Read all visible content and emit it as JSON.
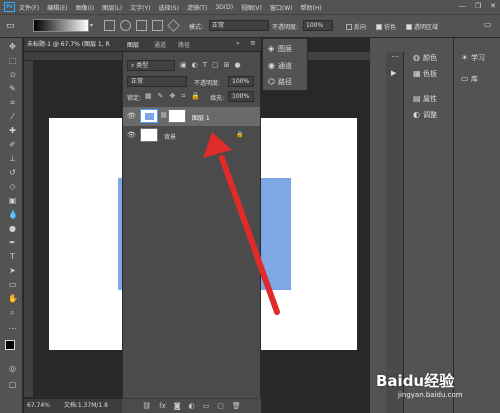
{
  "menubar": {
    "logo": "Ps",
    "items": [
      "文件(F)",
      "编辑(E)",
      "图像(I)",
      "图层(L)",
      "文字(Y)",
      "选择(S)",
      "滤镜(T)",
      "3D(D)",
      "视图(V)",
      "窗口(W)",
      "帮助(H)"
    ],
    "window_buttons": [
      "—",
      "❐",
      "✕"
    ]
  },
  "options": {
    "mode_label": "模式:",
    "mode_value": "正常",
    "opacity_label": "不透明度:",
    "opacity_value": "100%",
    "reverse_label": "反向",
    "dither_label": "仿色",
    "transparency_label": "透明区域"
  },
  "document": {
    "tab_title": "未标题-1 @ 67.7% (图层 1, R",
    "zoom": "67.74%",
    "doc_info": "文档:1.37M/1.8"
  },
  "layers_panel": {
    "tabs": [
      "图层",
      "通道",
      "路径"
    ],
    "filter_kind": "类型",
    "blend_mode": "正常",
    "opacity_label": "不透明度:",
    "opacity_value": "100%",
    "lock_label": "锁定:",
    "fill_label": "填充:",
    "fill_value": "100%",
    "layers": [
      {
        "name": "图层 1",
        "selected": true
      },
      {
        "name": "背景",
        "selected": false
      }
    ],
    "footer_icons": [
      "link-icon",
      "fx-icon",
      "mask-icon",
      "adjustment-icon",
      "folder-icon",
      "new-layer-icon",
      "trash-icon"
    ],
    "footer_glyphs": [
      "⛓",
      "fx",
      "◙",
      "◐",
      "▭",
      "▢",
      "🗑"
    ]
  },
  "mini_panel": {
    "items": [
      "图层",
      "通道",
      "路径"
    ]
  },
  "right_panel": {
    "group1": [
      "颜色",
      "色板"
    ],
    "group2": [
      "属性",
      "调整"
    ],
    "group3": [
      "学习",
      "库"
    ]
  },
  "watermark": {
    "text": "Baidu经验",
    "url": "jingyan.baidu.com"
  },
  "colors": {
    "accent_blue": "#7ea7e6",
    "arrow_red": "#e02b2b",
    "panel_bg": "#535353",
    "dark_bg": "#282828"
  }
}
